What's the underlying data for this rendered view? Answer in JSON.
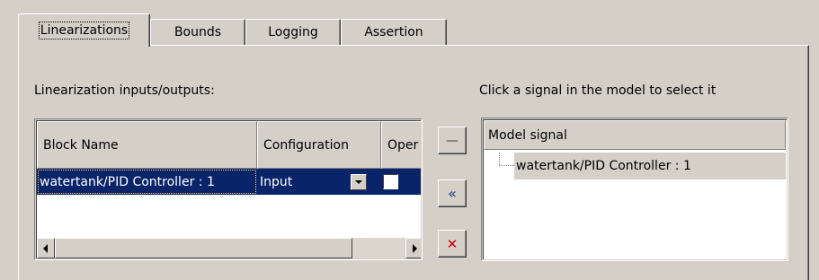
{
  "tabs": [
    {
      "label": "Linearizations",
      "active": true
    },
    {
      "label": "Bounds",
      "active": false
    },
    {
      "label": "Logging",
      "active": false
    },
    {
      "label": "Assertion",
      "active": false
    }
  ],
  "left_panel": {
    "label": "Linearization inputs/outputs:",
    "table": {
      "columns": [
        "Block Name",
        "Configuration",
        "Oper"
      ],
      "rows": [
        {
          "block_name": "watertank/PID Controller : 1",
          "configuration": "Input",
          "open_loop_checked": false,
          "selected": true
        }
      ]
    }
  },
  "buttons": {
    "remove_symbol": "—",
    "add_symbol": "«",
    "delete_symbol": "✕"
  },
  "right_panel": {
    "label": "Click a signal in the model to select it",
    "tree": {
      "header": "Model signal",
      "items": [
        "watertank/PID Controller : 1"
      ]
    }
  },
  "colors": {
    "background": "#d4d0c8",
    "selection": "#0a246a",
    "delete_icon": "#cc0000"
  },
  "icons": [
    "dropdown-arrow-icon",
    "scroll-left-icon",
    "scroll-right-icon",
    "remove-icon",
    "add-icon",
    "delete-icon"
  ]
}
